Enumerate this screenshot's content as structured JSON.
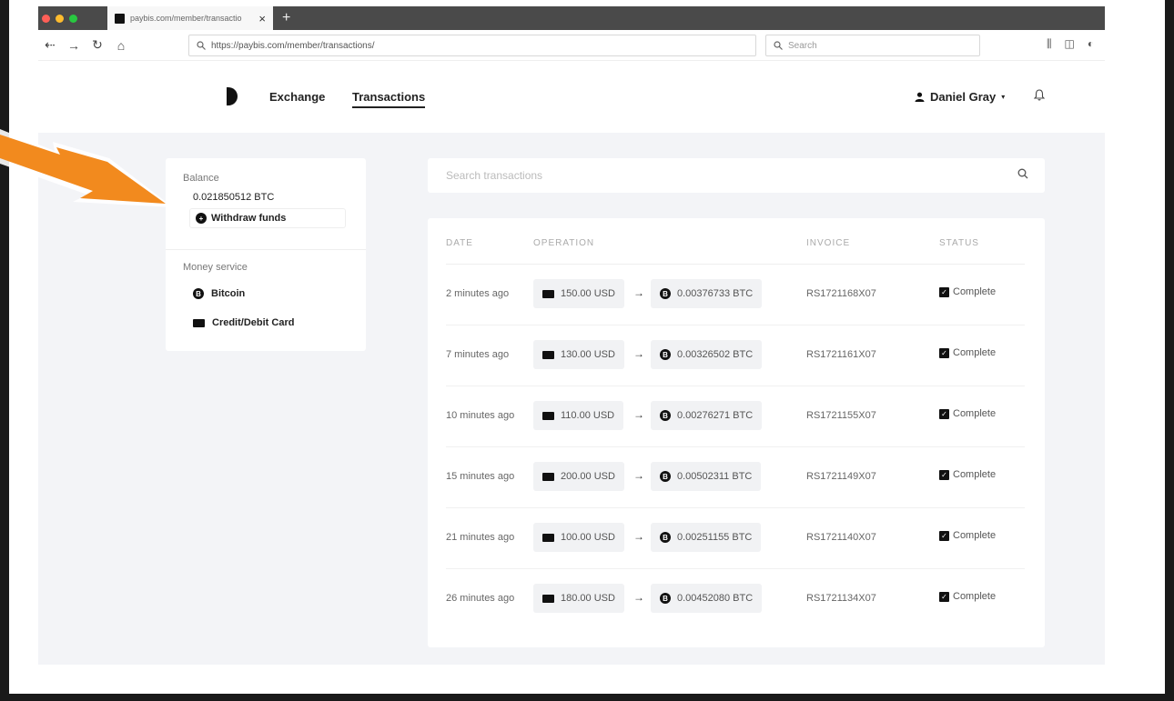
{
  "browser": {
    "tab_title": "paybis.com/member/transactio",
    "url": "https://paybis.com/member/transactions/",
    "search_placeholder": "Search",
    "traffic_colors": [
      "#ff5f57",
      "#febc2e",
      "#28c840"
    ]
  },
  "header": {
    "nav": {
      "exchange": "Exchange",
      "transactions": "Transactions"
    },
    "user_name": "Daniel Gray"
  },
  "sidebar": {
    "balance_label": "Balance",
    "balance_value": "0.021850512 BTC",
    "withdraw_label": "Withdraw funds",
    "money_service_label": "Money service",
    "services": [
      {
        "label": "Bitcoin",
        "icon": "bitcoin-icon"
      },
      {
        "label": "Credit/Debit Card",
        "icon": "card-icon"
      }
    ]
  },
  "search": {
    "placeholder": "Search transactions"
  },
  "table": {
    "columns": {
      "date": "DATE",
      "operation": "OPERATION",
      "invoice": "INVOICE",
      "status": "STATUS"
    },
    "rows": [
      {
        "date": "2 minutes ago",
        "from": "150.00 USD",
        "to": "0.00376733 BTC",
        "invoice": "RS1721168X07",
        "status": "Complete"
      },
      {
        "date": "7 minutes ago",
        "from": "130.00 USD",
        "to": "0.00326502 BTC",
        "invoice": "RS1721161X07",
        "status": "Complete"
      },
      {
        "date": "10 minutes ago",
        "from": "110.00 USD",
        "to": "0.00276271 BTC",
        "invoice": "RS1721155X07",
        "status": "Complete"
      },
      {
        "date": "15 minutes ago",
        "from": "200.00 USD",
        "to": "0.00502311 BTC",
        "invoice": "RS1721149X07",
        "status": "Complete"
      },
      {
        "date": "21 minutes ago",
        "from": "100.00 USD",
        "to": "0.00251155 BTC",
        "invoice": "RS1721140X07",
        "status": "Complete"
      },
      {
        "date": "26 minutes ago",
        "from": "180.00 USD",
        "to": "0.00452080 BTC",
        "invoice": "RS1721134X07",
        "status": "Complete"
      }
    ]
  },
  "colors": {
    "accent_arrow": "#f28a1e",
    "page_bg": "#f3f4f7"
  }
}
